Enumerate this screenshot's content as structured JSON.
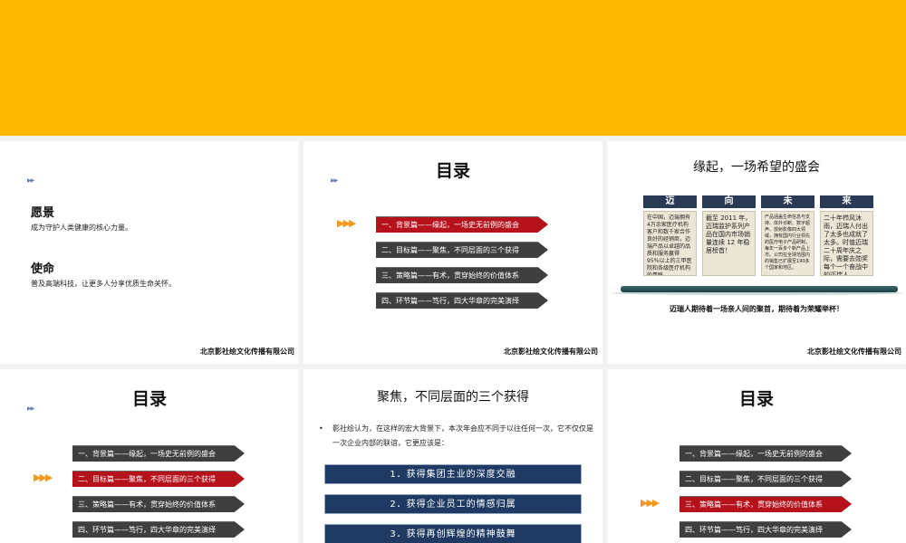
{
  "company": "北京影社绘文化传播有限公司",
  "slide_vision": {
    "vision_heading": "愿景",
    "vision_text": "成为守护人类健康的核心力量。",
    "mission_heading": "使命",
    "mission_text": "普及高端科技，让更多人分享优质生命关怀。"
  },
  "toc": {
    "title": "目录",
    "items": [
      "一、背景篇——缘起，一场史无前例的盛会",
      "二、目标篇——聚焦，不同层面的三个获得",
      "三、策略篇——有术，贯穿始终的价值体系",
      "四、环节篇——笃行，四大华章的完美演绎"
    ],
    "marker": "▶▶▶"
  },
  "slide_origin": {
    "title": "缘起，一场希望的盛会",
    "columns": [
      {
        "head": "迈",
        "text": "在中国，迈瑞拥有4万余家医疗机构客户和数千家合作良好的经销商，迈瑞产品以卓越的品质和服务赢得 95％以上的三甲医院和各级医疗机构的青睐"
      },
      {
        "head": "向",
        "text": "截至 2011 年，迈瑞监护系列产品在国内市场销量连续 12 年稳居榜首！"
      },
      {
        "head": "未",
        "text": "产品涵盖生命信息与支持、体外诊断、数字超声、放射影像四大领域，拥有国内行业领先的医疗电子产品研制，每年一百多个新产品上市。公司在全球范围内的销售已扩展至190多个国家和地区。"
      },
      {
        "head": "来",
        "text": "二十年栉风沐雨，迈瑞人付出了太多也成就了太多。时值迈瑞二十周年庆之际，需要去勋奖每个一个奋战中的迈瑞人。"
      }
    ],
    "caption": "迈瑞人期待着一场亲人间的聚首，期待着为荣耀举杯！"
  },
  "slide_focus": {
    "title": "聚焦，不同层面的三个获得",
    "bullet": "影社绘认为，在这样的宏大背景下，本次年会应不同于以往任何一次，它不仅仅是一次企业内部的联谊，它更应该是：",
    "gains": [
      "1．获得集团主业的深度交融",
      "2．获得企业员工的情感归属",
      "3．获得再创辉煌的精神鼓舞"
    ]
  },
  "colors": {
    "banner": "#FFB800",
    "toc_active": "#b5121b",
    "toc_inactive": "#3f3f3f",
    "gain_bar": "#1f3b63",
    "column_head": "#2a3a55"
  }
}
